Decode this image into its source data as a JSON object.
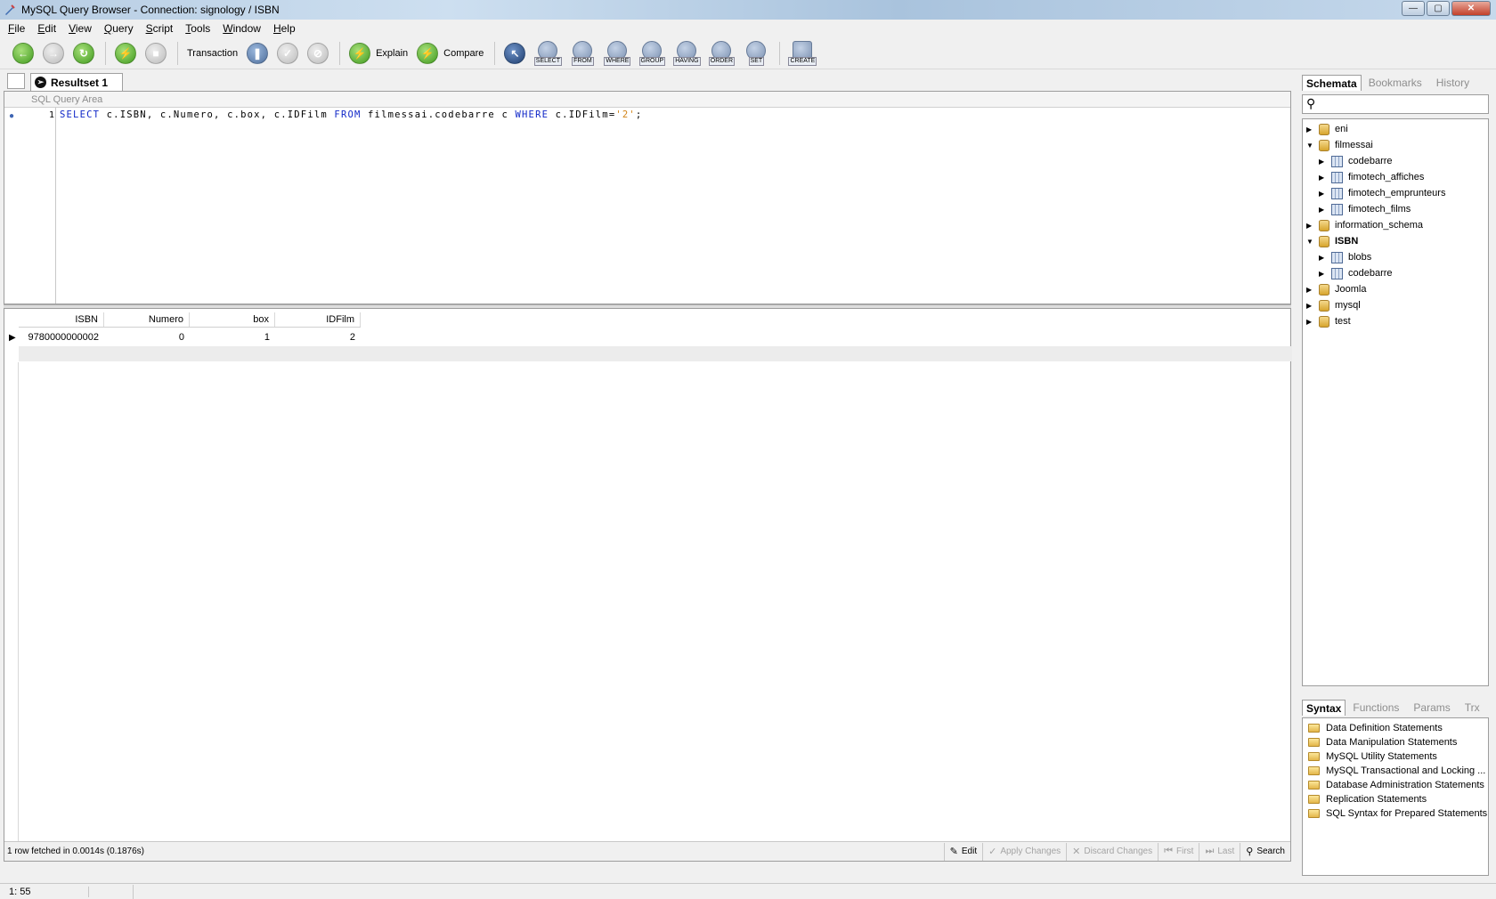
{
  "window": {
    "title": "MySQL Query Browser - Connection: signology / ISBN"
  },
  "menu": [
    "File",
    "Edit",
    "View",
    "Query",
    "Script",
    "Tools",
    "Window",
    "Help"
  ],
  "toolbar": {
    "transaction_label": "Transaction",
    "explain_label": "Explain",
    "compare_label": "Compare",
    "clauses": [
      "SELECT",
      "FROM",
      "WHERE",
      "GROUP",
      "HAVING",
      "ORDER",
      "SET"
    ],
    "create_label": "CREATE"
  },
  "tabs": {
    "active": "Resultset 1"
  },
  "query": {
    "area_title": "SQL Query Area",
    "line_number": "1",
    "sql": "SELECT c.ISBN, c.Numero, c.box, c.IDFilm FROM filmessai.codebarre c WHERE c.IDFilm='2';"
  },
  "results": {
    "columns": [
      "ISBN",
      "Numero",
      "box",
      "IDFilm"
    ],
    "rows": [
      [
        "9780000000002",
        "0",
        "1",
        "2"
      ]
    ],
    "status": "1 row fetched in 0.0014s (0.1876s)",
    "buttons": {
      "edit": "Edit",
      "apply": "Apply Changes",
      "discard": "Discard Changes",
      "first": "First",
      "last": "Last",
      "search": "Search"
    }
  },
  "schema_panel": {
    "tabs": [
      "Schemata",
      "Bookmarks",
      "History"
    ],
    "tree": [
      {
        "name": "eni",
        "type": "db",
        "expanded": false
      },
      {
        "name": "filmessai",
        "type": "db",
        "expanded": true,
        "children": [
          "codebarre",
          "fimotech_affiches",
          "fimotech_emprunteurs",
          "fimotech_films"
        ]
      },
      {
        "name": "information_schema",
        "type": "db",
        "expanded": false
      },
      {
        "name": "ISBN",
        "type": "db",
        "expanded": true,
        "bold": true,
        "children": [
          "blobs",
          "codebarre"
        ]
      },
      {
        "name": "Joomla",
        "type": "db",
        "expanded": false
      },
      {
        "name": "mysql",
        "type": "db",
        "expanded": false
      },
      {
        "name": "test",
        "type": "db",
        "expanded": false
      }
    ]
  },
  "syntax_panel": {
    "tabs": [
      "Syntax",
      "Functions",
      "Params",
      "Trx"
    ],
    "items": [
      "Data Definition Statements",
      "Data Manipulation Statements",
      "MySQL Utility Statements",
      "MySQL Transactional and Locking ...",
      "Database Administration Statements",
      "Replication Statements",
      "SQL Syntax for Prepared Statements"
    ]
  },
  "statusbar": {
    "position": "1: 55"
  }
}
